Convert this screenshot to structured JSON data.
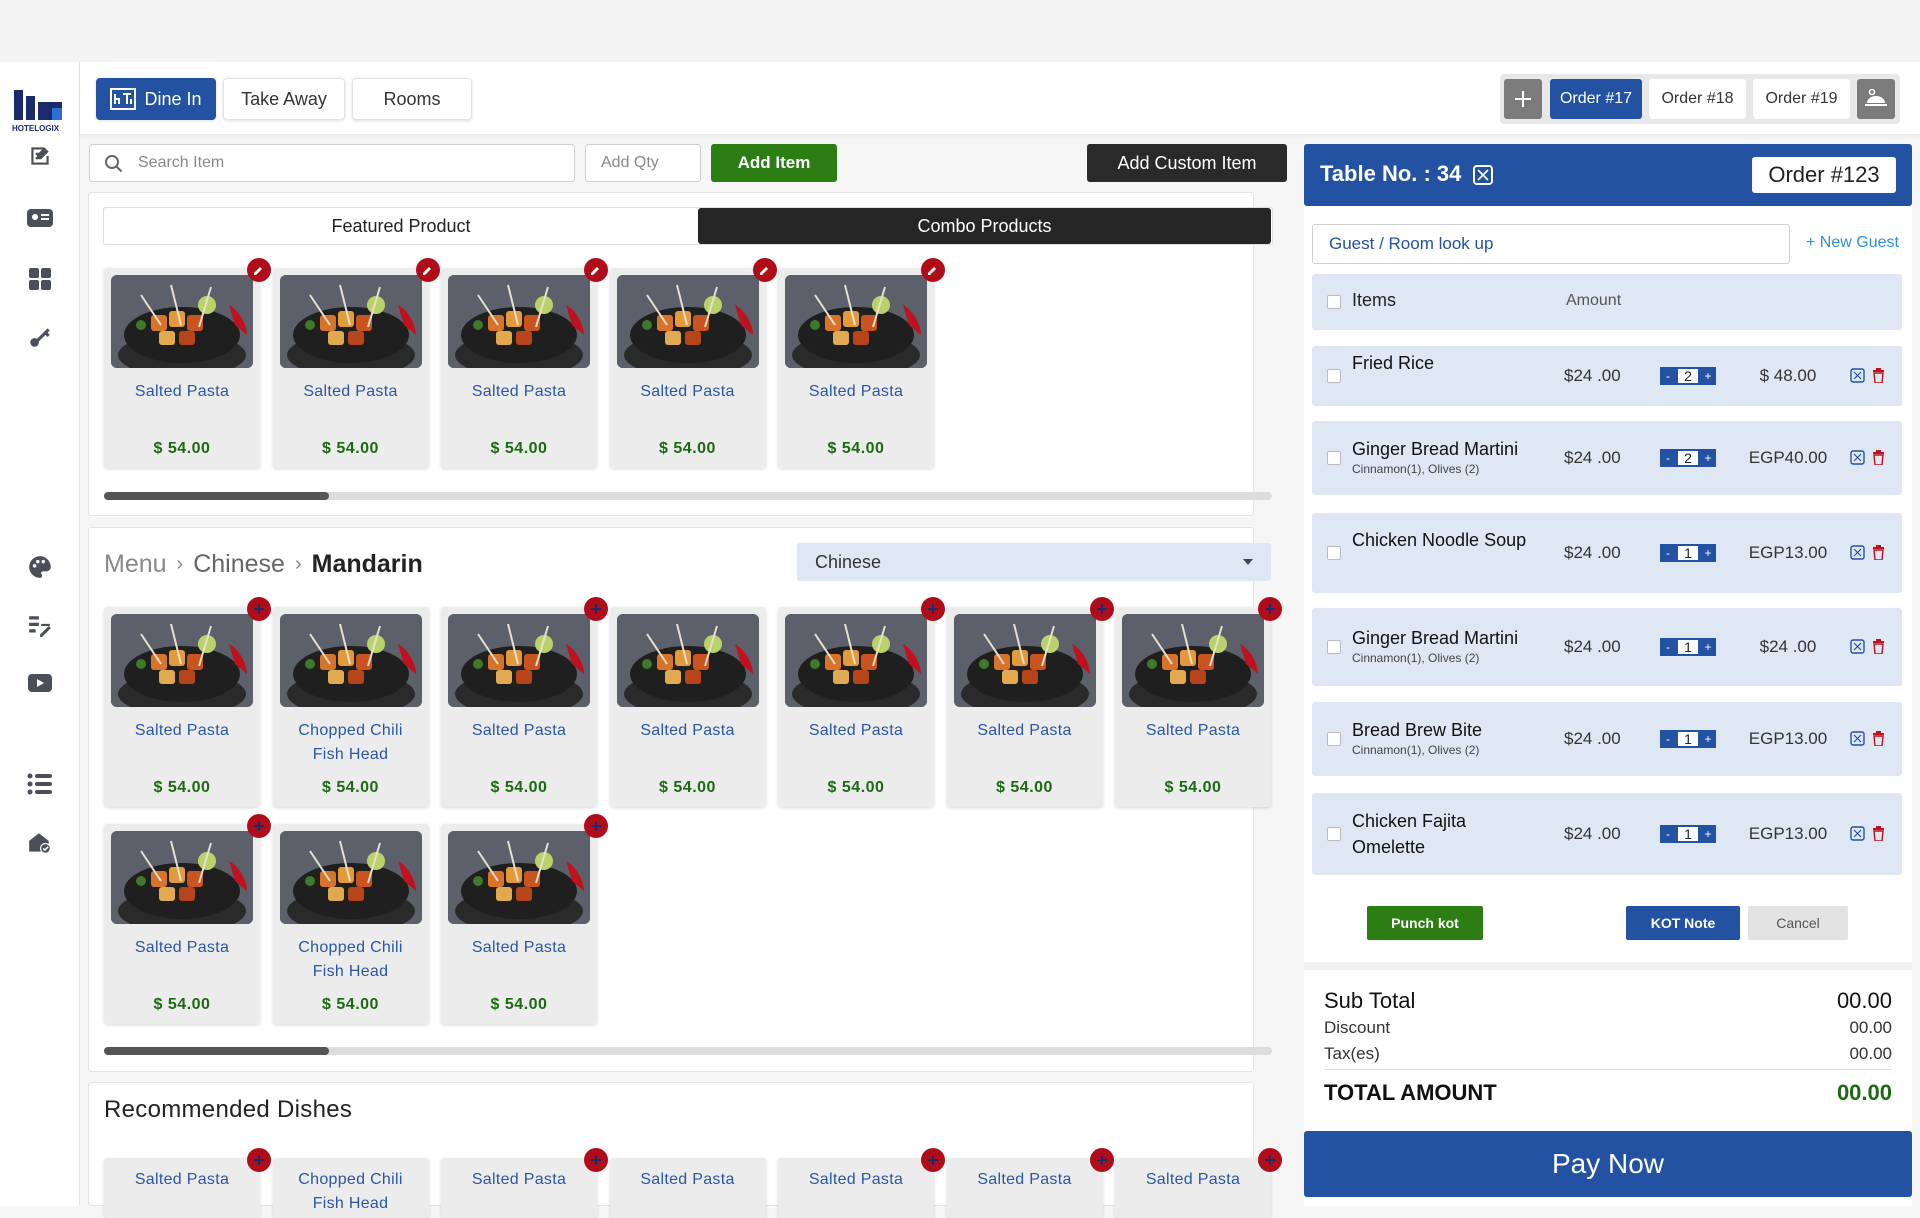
{
  "brand": {
    "logo_text": "HOTELOGIX"
  },
  "tabs": [
    {
      "label": "Dine In"
    },
    {
      "label": "Take Away"
    },
    {
      "label": "Rooms"
    }
  ],
  "orders": [
    {
      "label": "Order #17"
    },
    {
      "label": "Order #18"
    },
    {
      "label": "Order #19"
    }
  ],
  "search": {
    "placeholder": "Search Item",
    "qty_placeholder": "Add Qty",
    "add_item": "Add Item",
    "add_custom": "Add Custom Item"
  },
  "featured": {
    "tab1": "Featured Product",
    "tab2": "Combo Products",
    "items": [
      {
        "name": "Salted Pasta",
        "price": "$ 54.00"
      },
      {
        "name": "Salted Pasta",
        "price": "$ 54.00"
      },
      {
        "name": "Salted Pasta",
        "price": "$ 54.00"
      },
      {
        "name": "Salted Pasta",
        "price": "$ 54.00"
      },
      {
        "name": "Salted Pasta",
        "price": "$ 54.00"
      }
    ]
  },
  "menu": {
    "crumb1": "Menu",
    "crumb2": "Chinese",
    "crumb3": "Mandarin",
    "select": "Chinese",
    "items": [
      {
        "name": "Salted Pasta",
        "price": "$ 54.00"
      },
      {
        "name": "Chopped Chili Fish Head",
        "price": "$ 54.00"
      },
      {
        "name": "Salted Pasta",
        "price": "$ 54.00"
      },
      {
        "name": "Salted Pasta",
        "price": "$ 54.00"
      },
      {
        "name": "Salted Pasta",
        "price": "$ 54.00"
      },
      {
        "name": "Salted Pasta",
        "price": "$ 54.00"
      },
      {
        "name": "Salted Pasta",
        "price": "$ 54.00"
      },
      {
        "name": "Salted Pasta",
        "price": "$ 54.00"
      },
      {
        "name": "Chopped Chili Fish Head",
        "price": "$ 54.00"
      },
      {
        "name": "Salted Pasta",
        "price": "$ 54.00"
      }
    ]
  },
  "recommended": {
    "title": "Recommended Dishes",
    "items": [
      {
        "name": "Salted Pasta"
      },
      {
        "name": "Chopped Chili Fish Head"
      },
      {
        "name": "Salted Pasta"
      },
      {
        "name": "Salted Pasta"
      },
      {
        "name": "Salted Pasta"
      },
      {
        "name": "Salted Pasta"
      },
      {
        "name": "Salted Pasta"
      }
    ]
  },
  "cart": {
    "table": "Table No. : 34",
    "order": "Order #123",
    "guest_placeholder": "Guest / Room  look up",
    "new_guest": "+ New Guest",
    "col_items": "Items",
    "col_amount": "Amount",
    "rows": [
      {
        "name": "Fried Rice",
        "sub": "",
        "price": "$24 .00",
        "qty": "2",
        "total": "$ 48.00"
      },
      {
        "name": "Ginger Bread Martini",
        "sub": "Cinnamon(1), Olives (2)",
        "price": "$24 .00",
        "qty": "2",
        "total": "EGP40.00"
      },
      {
        "name": "Chicken Noodle Soup",
        "sub": "",
        "price": "$24 .00",
        "qty": "1",
        "total": "EGP13.00"
      },
      {
        "name": "Ginger Bread Martini",
        "sub": "Cinnamon(1), Olives (2)",
        "price": "$24 .00",
        "qty": "1",
        "total": "$24 .00"
      },
      {
        "name": "Bread Brew Bite",
        "sub": "Cinnamon(1), Olives (2)",
        "price": "$24 .00",
        "qty": "1",
        "total": "EGP13.00"
      },
      {
        "name": "Chicken Fajita Omelette",
        "sub": "",
        "price": "$24 .00",
        "qty": "1",
        "total": "EGP13.00"
      }
    ],
    "punch": "Punch kot",
    "kot_note": "KOT Note",
    "cancel": "Cancel",
    "subtotal_label": "Sub Total",
    "subtotal": "00.00",
    "discount_label": "Discount",
    "discount": "00.00",
    "tax_label": "Tax(es)",
    "tax": "00.00",
    "total_label": "TOTAL AMOUNT",
    "total": "00.00",
    "pay": "Pay Now"
  },
  "colors": {
    "primary": "#2352a3",
    "green": "#2b7d14",
    "red": "#b00d1a"
  }
}
